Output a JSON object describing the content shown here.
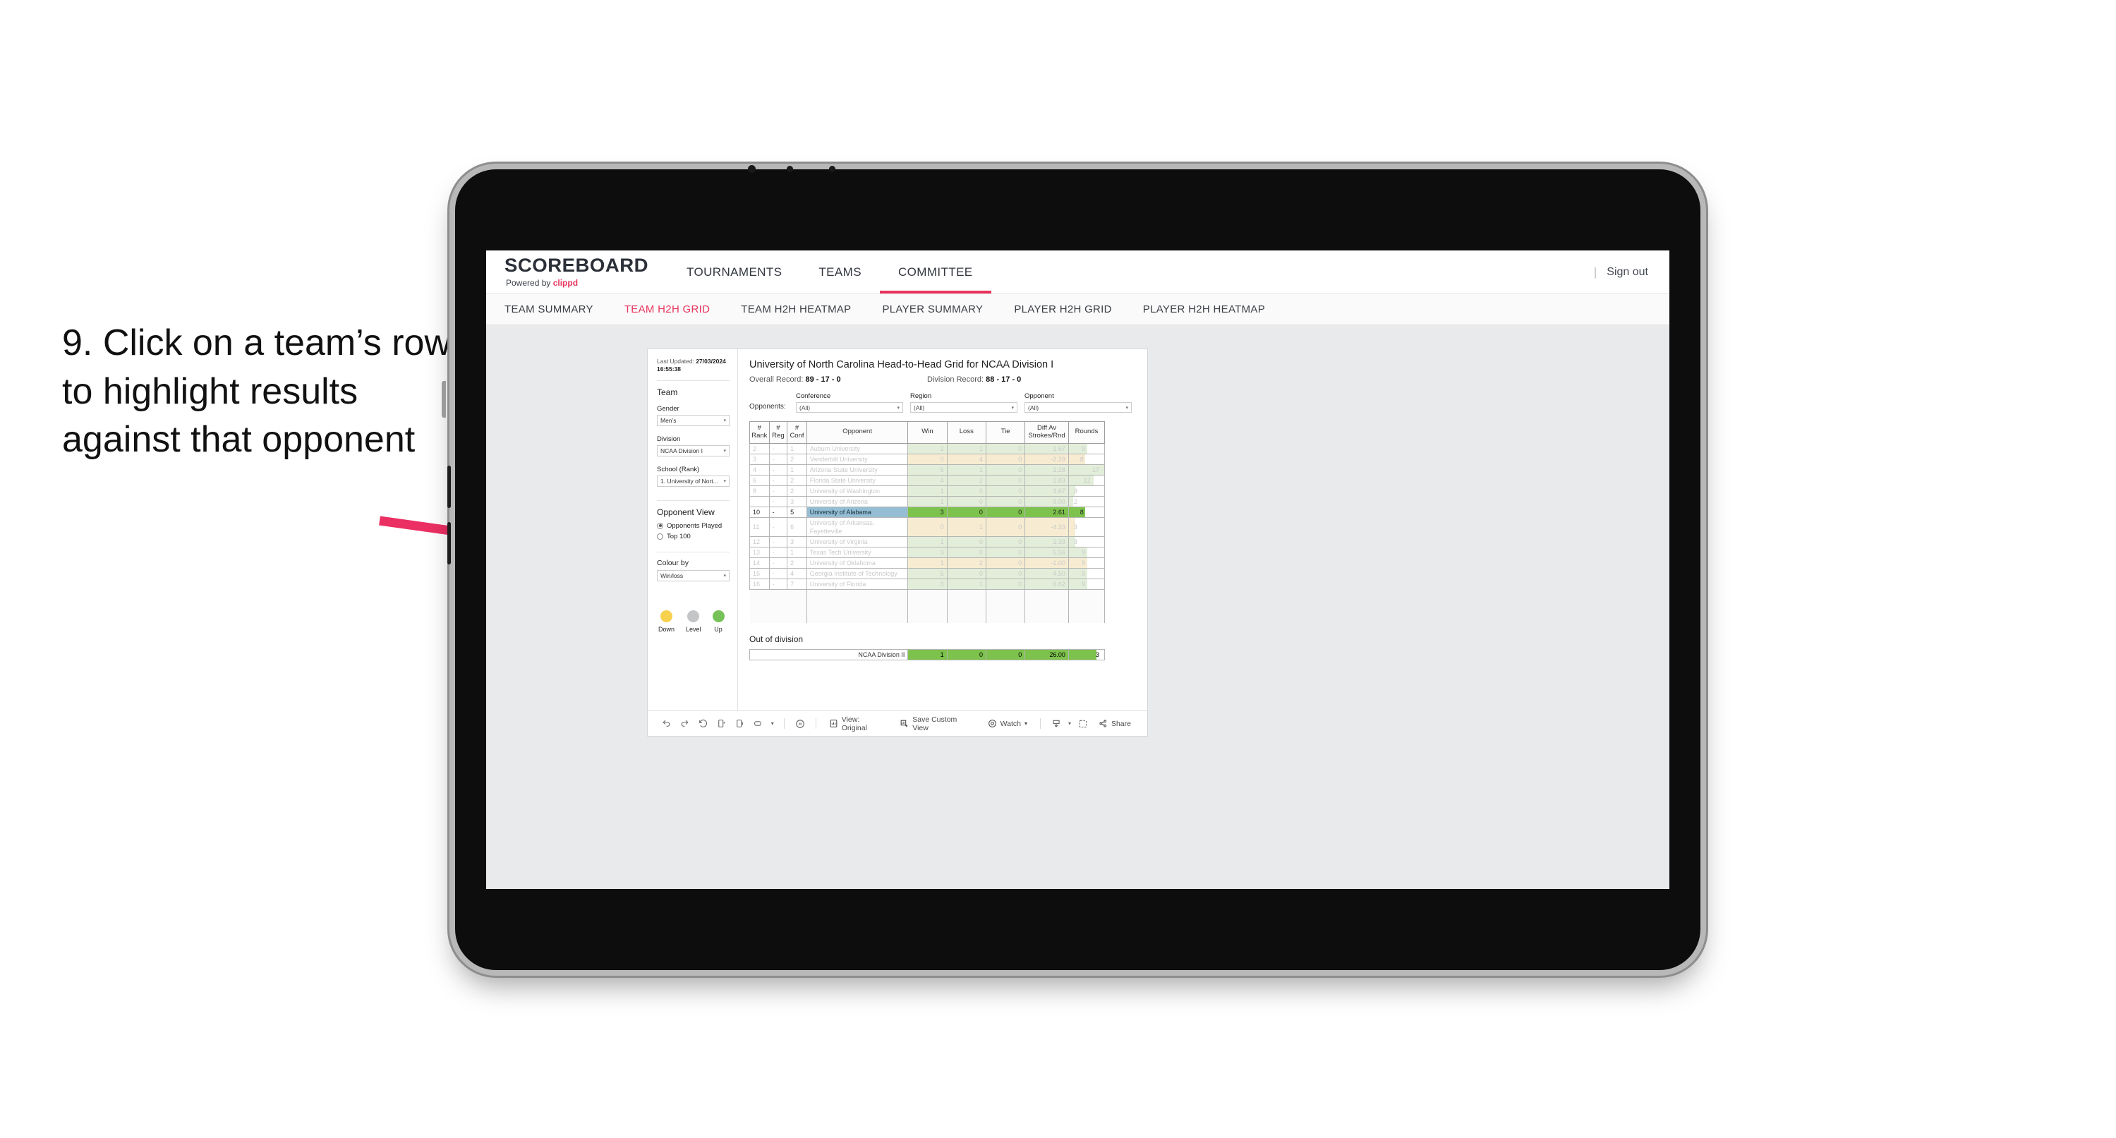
{
  "annotation": {
    "text": "9. Click on a team’s row to highlight results against that opponent",
    "arrow_color": "#ec2f63"
  },
  "app": {
    "brand": {
      "title": "SCOREBOARD",
      "powered_prefix": "Powered by",
      "powered_brand": "clippd"
    },
    "nav_tabs": [
      {
        "label": "TOURNAMENTS",
        "active": false
      },
      {
        "label": "TEAMS",
        "active": false
      },
      {
        "label": "COMMITTEE",
        "active": true
      }
    ],
    "nav_divider": "|",
    "sign_out": "Sign out",
    "sub_tabs": [
      {
        "label": "TEAM SUMMARY",
        "active": false
      },
      {
        "label": "TEAM H2H GRID",
        "active": true
      },
      {
        "label": "TEAM H2H HEATMAP",
        "active": false
      },
      {
        "label": "PLAYER SUMMARY",
        "active": false
      },
      {
        "label": "PLAYER H2H GRID",
        "active": false
      },
      {
        "label": "PLAYER H2H HEATMAP",
        "active": false
      }
    ],
    "accent_color": "#e8335c"
  },
  "filters": {
    "last_updated_label": "Last Updated:",
    "last_updated_value": "27/03/2024 16:55:38",
    "team_heading": "Team",
    "gender": {
      "label": "Gender",
      "value": "Men’s"
    },
    "division": {
      "label": "Division",
      "value": "NCAA Division I"
    },
    "school": {
      "label": "School (Rank)",
      "value": "1. University of Nort..."
    },
    "opponent_view": {
      "heading": "Opponent View",
      "options": [
        {
          "label": "Opponents Played",
          "selected": true
        },
        {
          "label": "Top 100",
          "selected": false
        }
      ]
    },
    "colour_by": {
      "label": "Colour by",
      "value": "Win/loss"
    },
    "legend": [
      {
        "label": "Down",
        "color": "#f5d14e"
      },
      {
        "label": "Level",
        "color": "#c3c5c7"
      },
      {
        "label": "Up",
        "color": "#77c159"
      }
    ]
  },
  "viz": {
    "title": "University of North Carolina Head-to-Head Grid for NCAA Division I",
    "overall_record_label": "Overall Record:",
    "overall_record_value": "89 - 17 - 0",
    "division_record_label": "Division Record:",
    "division_record_value": "88 - 17 - 0",
    "opponents_label": "Opponents:",
    "opponent_filters": [
      {
        "label": "Conference",
        "value": "(All)"
      },
      {
        "label": "Region",
        "value": "(All)"
      },
      {
        "label": "Opponent",
        "value": "(All)"
      }
    ],
    "columns": [
      "# Rank",
      "# Reg",
      "# Conf",
      "Opponent",
      "Win",
      "Loss",
      "Tie",
      "Diff Av Strokes/Rnd",
      "Rounds"
    ],
    "column_header_lines": [
      [
        "#",
        "Rank"
      ],
      [
        "#",
        "Reg"
      ],
      [
        "#",
        "Conf"
      ],
      [
        "Opponent"
      ],
      [
        "Win"
      ],
      [
        "Loss"
      ],
      [
        "Tie"
      ],
      [
        "Diff Av",
        "Strokes/Rnd"
      ],
      [
        "Rounds"
      ]
    ],
    "out_of_division_title": "Out of division",
    "out_of_division_row": {
      "name": "NCAA Division II",
      "win": "1",
      "loss": "0",
      "tie": "0",
      "diff": "26.00",
      "rounds": "3"
    }
  },
  "chart_data": {
    "type": "table",
    "title": "University of North Carolina Head-to-Head Grid for NCAA Division I",
    "columns": [
      "# Rank",
      "# Reg",
      "# Conf",
      "Opponent",
      "Win",
      "Loss",
      "Tie",
      "Diff Av Strokes/Rnd",
      "Rounds"
    ],
    "rows": [
      {
        "rank": "2",
        "reg": "-",
        "conf": "1",
        "opponent": "Auburn University",
        "win": "2",
        "loss": "1",
        "tie": "0",
        "diff": "1.67",
        "rounds": "9",
        "result": "up",
        "selected": false
      },
      {
        "rank": "3",
        "reg": "-",
        "conf": "2",
        "opponent": "Vanderbilt University",
        "win": "0",
        "loss": "4",
        "tie": "0",
        "diff": "-2.29",
        "rounds": "8",
        "result": "down",
        "selected": false
      },
      {
        "rank": "4",
        "reg": "-",
        "conf": "1",
        "opponent": "Arizona State University",
        "win": "5",
        "loss": "1",
        "tie": "0",
        "diff": "2.28",
        "rounds": "17",
        "result": "up",
        "selected": false
      },
      {
        "rank": "6",
        "reg": "-",
        "conf": "2",
        "opponent": "Florida State University",
        "win": "4",
        "loss": "2",
        "tie": "0",
        "diff": "1.83",
        "rounds": "12",
        "result": "up",
        "selected": false
      },
      {
        "rank": "8",
        "reg": "-",
        "conf": "2",
        "opponent": "University of Washington",
        "win": "1",
        "loss": "0",
        "tie": "0",
        "diff": "3.67",
        "rounds": "3",
        "result": "up",
        "selected": false
      },
      {
        "rank": "",
        "reg": "-",
        "conf": "3",
        "opponent": "University of Arizona",
        "win": "1",
        "loss": "0",
        "tie": "0",
        "diff": "9.00",
        "rounds": "2",
        "result": "up",
        "selected": false
      },
      {
        "rank": "10",
        "reg": "-",
        "conf": "5",
        "opponent": "University of Alabama",
        "win": "3",
        "loss": "0",
        "tie": "0",
        "diff": "2.61",
        "rounds": "8",
        "result": "up",
        "selected": true
      },
      {
        "rank": "11",
        "reg": "-",
        "conf": "6",
        "opponent": "University of Arkansas, Fayetteville",
        "win": "0",
        "loss": "1",
        "tie": "0",
        "diff": "-4.33",
        "rounds": "3",
        "result": "down",
        "selected": false
      },
      {
        "rank": "12",
        "reg": "-",
        "conf": "3",
        "opponent": "University of Virginia",
        "win": "1",
        "loss": "0",
        "tie": "0",
        "diff": "2.33",
        "rounds": "3",
        "result": "up",
        "selected": false
      },
      {
        "rank": "13",
        "reg": "-",
        "conf": "1",
        "opponent": "Texas Tech University",
        "win": "3",
        "loss": "0",
        "tie": "0",
        "diff": "5.56",
        "rounds": "9",
        "result": "up",
        "selected": false
      },
      {
        "rank": "14",
        "reg": "-",
        "conf": "2",
        "opponent": "University of Oklahoma",
        "win": "1",
        "loss": "2",
        "tie": "0",
        "diff": "-1.00",
        "rounds": "9",
        "result": "down",
        "selected": false
      },
      {
        "rank": "15",
        "reg": "-",
        "conf": "4",
        "opponent": "Georgia Institute of Technology",
        "win": "5",
        "loss": "0",
        "tie": "0",
        "diff": "4.50",
        "rounds": "9",
        "result": "up",
        "selected": false
      },
      {
        "rank": "16",
        "reg": "-",
        "conf": "7",
        "opponent": "University of Florida",
        "win": "3",
        "loss": "1",
        "tie": "0",
        "diff": "6.62",
        "rounds": "9",
        "result": "up",
        "selected": false
      }
    ],
    "out_of_division": [
      {
        "name": "NCAA Division II",
        "win": "1",
        "loss": "0",
        "tie": "0",
        "diff": "26.00",
        "rounds": "3",
        "result": "up"
      }
    ],
    "colors": {
      "up": "#e2eed9",
      "down": "#f7ecd1",
      "selected_up": "#7dc24c",
      "selected_opponent": "#95bdd4"
    },
    "max_rounds": 17
  },
  "toolbar": {
    "view_label": "View: Original",
    "save_label": "Save Custom View",
    "watch_label": "Watch",
    "share_label": "Share"
  }
}
